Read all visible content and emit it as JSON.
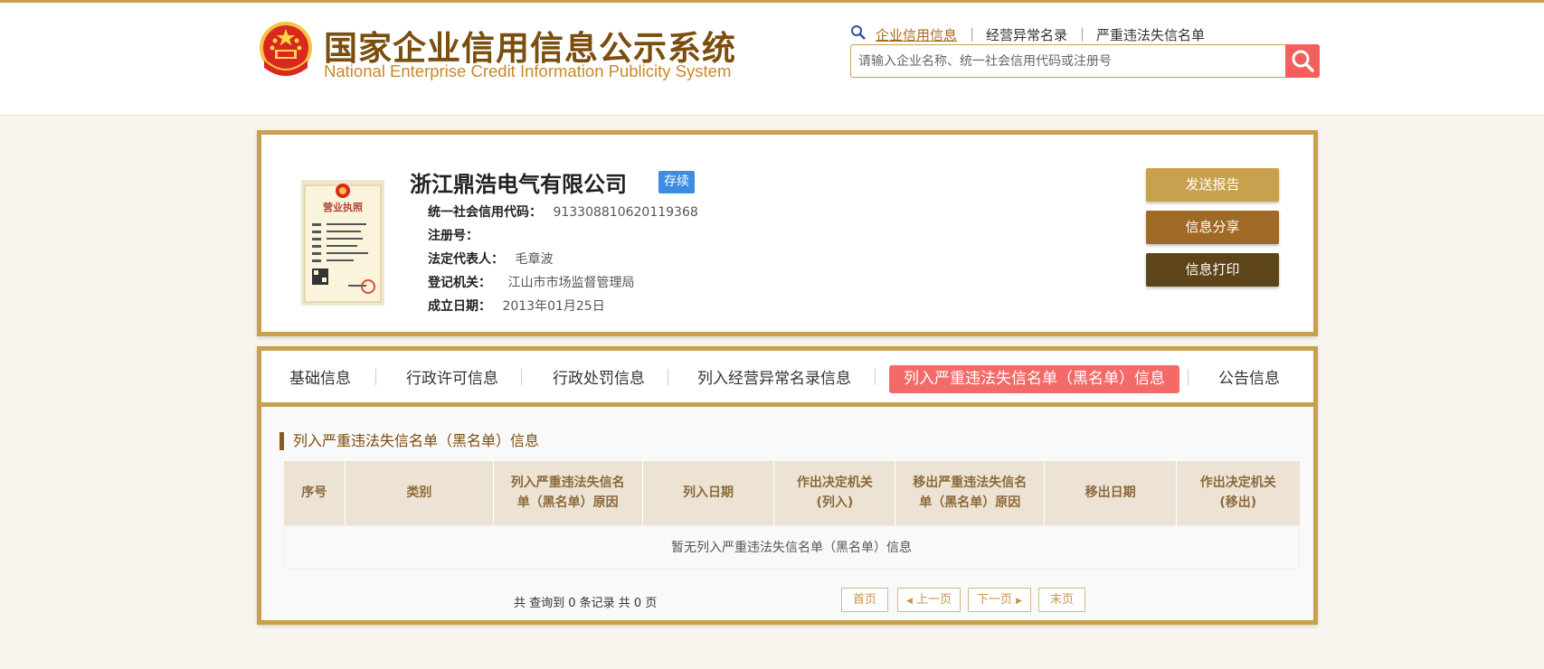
{
  "header": {
    "title_cn": "国家企业信用信息公示系统",
    "title_en": "National Enterprise Credit Information Publicity System",
    "nav": [
      {
        "label": "企业信用信息"
      },
      {
        "label": "经营异常名录"
      },
      {
        "label": "严重违法失信名单"
      }
    ],
    "nav_separator": "|",
    "search": {
      "placeholder": "请输入企业名称、统一社会信用代码或注册号",
      "value": ""
    }
  },
  "company": {
    "name": "浙江鼎浩电气有限公司",
    "status": "存续",
    "license_image_text": "营业执照",
    "fields": [
      {
        "label": "统一社会信用代码：",
        "value": "913308810620119368"
      },
      {
        "label": "注册号：",
        "value": ""
      },
      {
        "label": "法定代表人：",
        "value": "毛章波"
      },
      {
        "label": "登记机关：",
        "value": "江山市市场监督管理局"
      },
      {
        "label": "成立日期：",
        "value": "2013年01月25日"
      }
    ],
    "actions": [
      {
        "label": "发送报告",
        "color": "#c9a04d"
      },
      {
        "label": "信息分享",
        "color": "#a06a26"
      },
      {
        "label": "信息打印",
        "color": "#5e4419"
      }
    ]
  },
  "tabs": [
    {
      "label": "基础信息",
      "active": false
    },
    {
      "label": "行政许可信息",
      "active": false
    },
    {
      "label": "行政处罚信息",
      "active": false
    },
    {
      "label": "列入经营异常名录信息",
      "active": false
    },
    {
      "label": "列入严重违法失信名单（黑名单）信息",
      "active": true
    },
    {
      "label": "公告信息",
      "active": false
    }
  ],
  "section": {
    "title": "列入严重违法失信名单（黑名单）信息",
    "table": {
      "columns": [
        {
          "line1": "序号",
          "line2": ""
        },
        {
          "line1": "类别",
          "line2": ""
        },
        {
          "line1": "列入严重违法失信名",
          "line2": "单（黑名单）原因"
        },
        {
          "line1": "列入日期",
          "line2": ""
        },
        {
          "line1": "作出决定机关",
          "line2": "(列入)"
        },
        {
          "line1": "移出严重违法失信名",
          "line2": "单（黑名单）原因"
        },
        {
          "line1": "移出日期",
          "line2": ""
        },
        {
          "line1": "作出决定机关",
          "line2": "(移出)"
        }
      ],
      "empty_message": "暂无列入严重违法失信名单（黑名单）信息"
    },
    "pagination": {
      "summary": "共 查询到 0 条记录 共 0 页",
      "first": "首页",
      "prev": "上一页",
      "next": "下一页",
      "last": "末页"
    }
  },
  "colors": {
    "accent_gold": "#c9a04d",
    "brand_brown": "#7a4e0f",
    "active_tab": "#f26b68",
    "status_badge": "#3a8de0",
    "search_button": "#f25f5c"
  }
}
